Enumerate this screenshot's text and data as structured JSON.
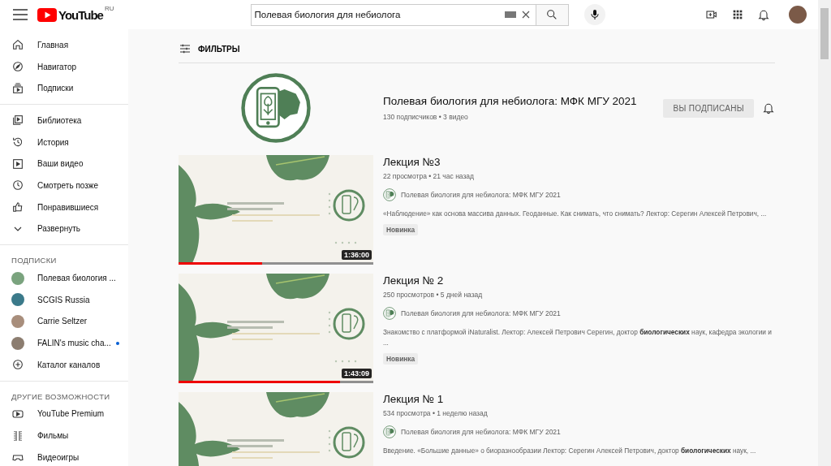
{
  "header": {
    "logo_text": "YouTube",
    "region": "RU",
    "search": {
      "value": "Полевая биология для небиолога"
    }
  },
  "sidebar": {
    "sections": [
      {
        "items": [
          {
            "label": "Главная",
            "kind": "nav",
            "selected": false
          },
          {
            "label": "Навигатор",
            "kind": "nav",
            "selected": false
          },
          {
            "label": "Подписки",
            "kind": "nav",
            "selected": false
          }
        ]
      },
      {
        "items": [
          {
            "label": "Библиотека",
            "kind": "nav",
            "selected": false
          },
          {
            "label": "История",
            "kind": "nav",
            "selected": false
          },
          {
            "label": "Ваши видео",
            "kind": "nav",
            "selected": false
          },
          {
            "label": "Смотреть позже",
            "kind": "nav",
            "selected": false
          },
          {
            "label": "Понравившиеся",
            "kind": "nav",
            "selected": false
          },
          {
            "label": "Развернуть",
            "kind": "nav",
            "selected": false
          }
        ]
      },
      {
        "title": "ПОДПИСКИ",
        "items": [
          {
            "label": "Полевая биология ...",
            "kind": "channel",
            "selected": false,
            "new": false
          },
          {
            "label": "SCGIS Russia",
            "kind": "channel",
            "selected": false,
            "new": false
          },
          {
            "label": "Carrie Seltzer",
            "kind": "channel",
            "selected": false,
            "new": false
          },
          {
            "label": "FALIN's music cha...",
            "kind": "channel",
            "selected": false,
            "new": true
          },
          {
            "label": "Каталог каналов",
            "kind": "nav",
            "selected": false
          }
        ]
      },
      {
        "title": "ДРУГИЕ ВОЗМОЖНОСТИ",
        "items": [
          {
            "label": "YouTube Premium",
            "kind": "nav",
            "selected": false
          },
          {
            "label": "Фильмы",
            "kind": "nav",
            "selected": false
          },
          {
            "label": "Видеоигры",
            "kind": "nav",
            "selected": false
          }
        ]
      }
    ]
  },
  "filters": {
    "label": "ФИЛЬТРЫ"
  },
  "channel": {
    "name": "Полевая биология для небиолога: МФК МГУ 2021",
    "stats": "130 подписчиков • 3 видео",
    "subscribe_button": "ВЫ ПОДПИСАНЫ",
    "subscribed": true
  },
  "videos": [
    {
      "title": "Лекция №3",
      "meta": "22 просмотра • 21 час назад",
      "channel": "Полевая биология для небиолога: МФК МГУ 2021",
      "description": "«Наблюдение» как основа массива данных. Геоданные. Как снимать, что снимать? Лектор: Серегин Алексей Петрович, ...",
      "badge": "Новинка",
      "duration": "1:36:00",
      "level": 0.43
    },
    {
      "title": "Лекция № 2",
      "meta": "250 просмотров • 5 дней назад",
      "channel": "Полевая биология для небиолога: МФК МГУ 2021",
      "description": "Знакомство с платформой iNaturalist. Лектор: Алексей Петрович Серегин, доктор **биологических** наук, кафедра экологии и ...",
      "badge": "Новинка",
      "duration": "1:43:09",
      "level": 0.83
    },
    {
      "title": "Лекция № 1",
      "meta": "534 просмотра • 1 неделю назад",
      "channel": "Полевая биология для небиолога: МФК МГУ 2021",
      "description": "Введение. «Большие данные» о биоразнообразии Лектор: Серегин Алексей Петрович, доктор **биологических** наук, ..."
    }
  ]
}
